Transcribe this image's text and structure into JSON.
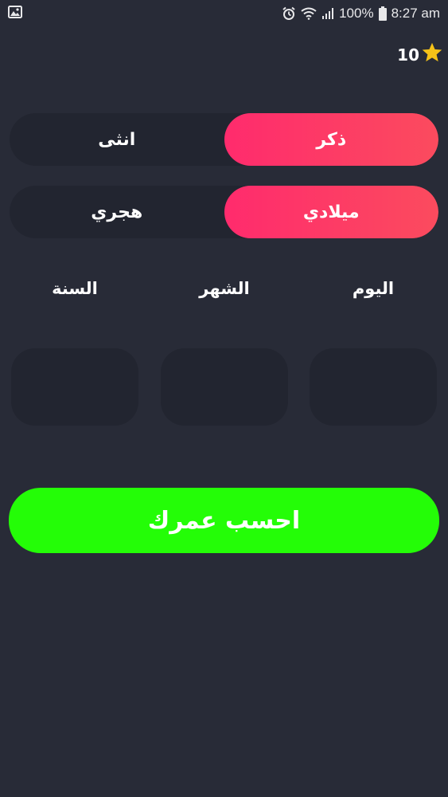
{
  "status_bar": {
    "battery": "100%",
    "time": "8:27 am"
  },
  "coins": {
    "count": "10",
    "icon": "star-icon",
    "icon_color": "#f5c218"
  },
  "gender": {
    "options": [
      {
        "label": "ذكر",
        "active": true
      },
      {
        "label": "انثى",
        "active": false
      }
    ]
  },
  "calendar": {
    "options": [
      {
        "label": "ميلادي",
        "active": true
      },
      {
        "label": "هجري",
        "active": false
      }
    ]
  },
  "date_labels": {
    "day": "اليوم",
    "month": "الشهر",
    "year": "السنة"
  },
  "inputs": {
    "day_value": "",
    "month_value": "",
    "year_value": ""
  },
  "calculate_button": {
    "label": "احسب عمرك",
    "color": "#24fd07"
  },
  "colors": {
    "background": "#282b37",
    "accent": "#ff2b6d",
    "segment_bg": "#222530"
  }
}
